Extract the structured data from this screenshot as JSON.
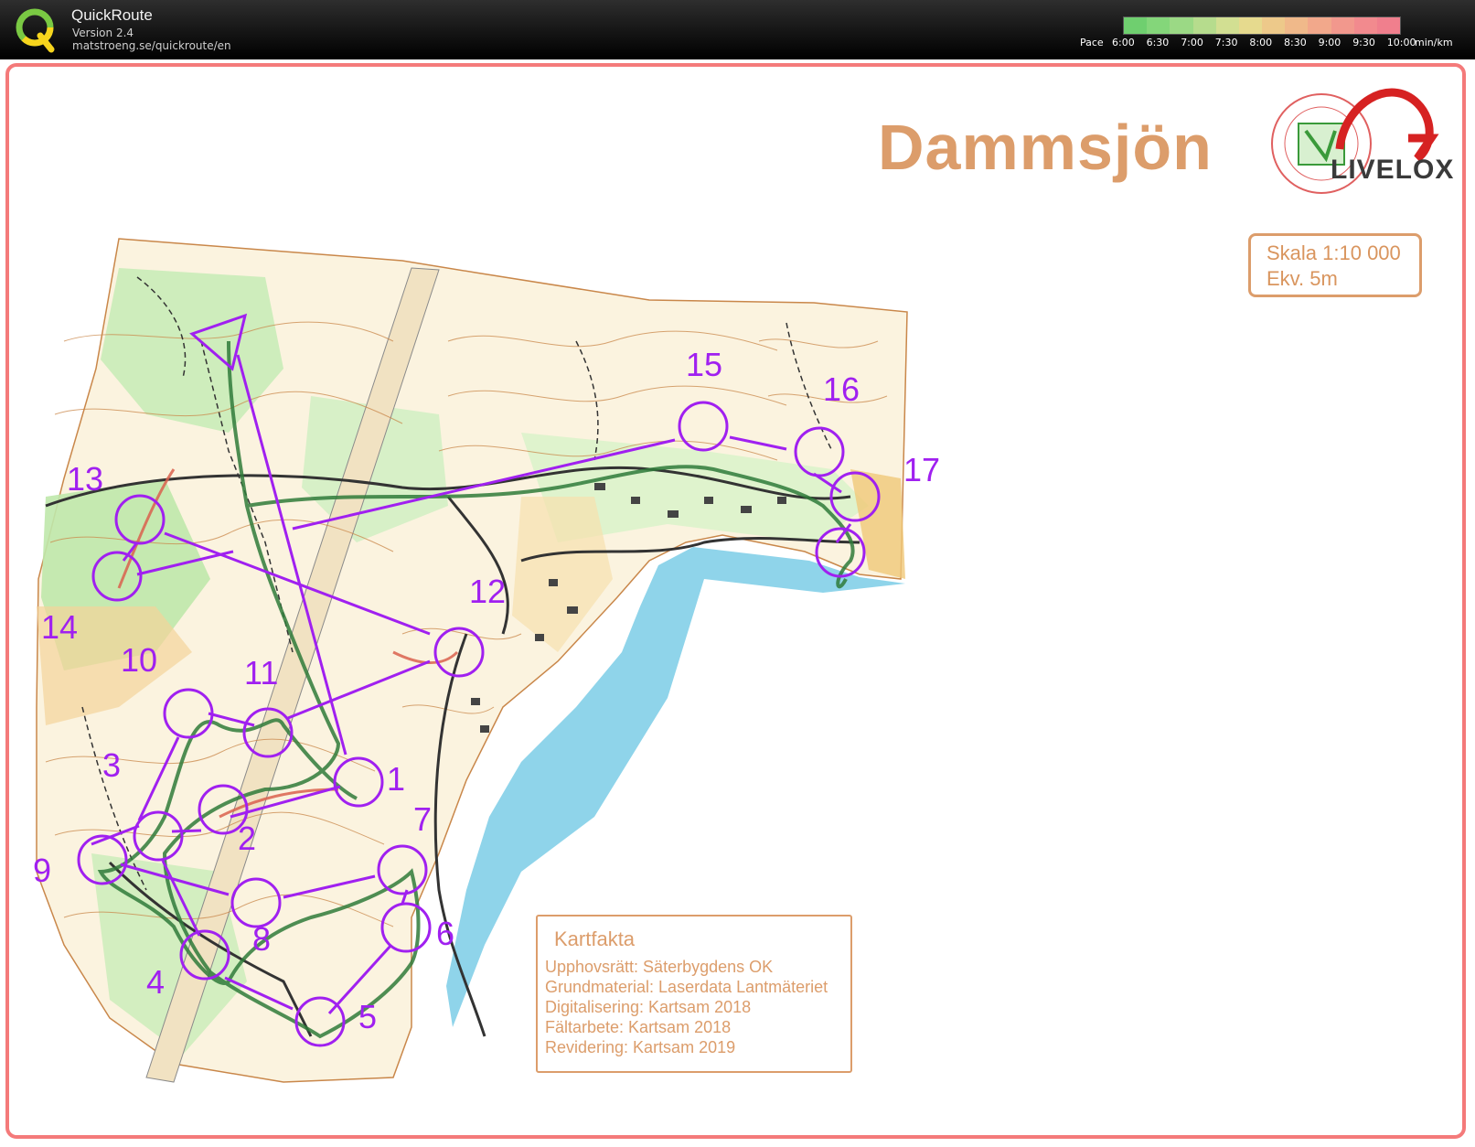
{
  "app": {
    "title": "QuickRoute",
    "version": "Version 2.4",
    "url": "matstroeng.se/quickroute/en"
  },
  "pace_scale": {
    "label": "Pace",
    "ticks": [
      "6:00",
      "6:30",
      "7:00",
      "7:30",
      "8:00",
      "8:30",
      "9:00",
      "9:30",
      "10:00"
    ],
    "unit": "min/km",
    "colors": [
      "#6fcf6f",
      "#84d67a",
      "#9bd985",
      "#b6dc8d",
      "#d2df92",
      "#e6da8e",
      "#edc98a",
      "#f0b98a",
      "#f2a88b",
      "#f2988d",
      "#f28a8e",
      "#f07f8d"
    ]
  },
  "map": {
    "title": "Dammsjön",
    "scale": "Skala 1:10 000",
    "equidistance": "Ekv. 5m",
    "brand": "LIVELOX",
    "kartfakta": {
      "title": "Kartfakta",
      "lines": [
        "Upphovsrätt: Säterbygdens OK",
        "Grundmaterial: Laserdata Lantmäteriet",
        "Digitalisering: Kartsam 2018",
        "Fältarbete: Kartsam 2018",
        "Revidering: Kartsam 2019"
      ]
    },
    "controls": [
      "1",
      "2",
      "3",
      "4",
      "5",
      "6",
      "7",
      "8",
      "9",
      "10",
      "11",
      "12",
      "13",
      "14",
      "15",
      "16",
      "17"
    ],
    "colors": {
      "frame": "#f47a7a",
      "course": "#a020f0",
      "title": "#dc9d6b",
      "water": "#8fd4ea",
      "forest": "#c9ecb8",
      "open": "#f3d39a",
      "contour": "#c9874a",
      "route": "#2f7a3a"
    }
  }
}
